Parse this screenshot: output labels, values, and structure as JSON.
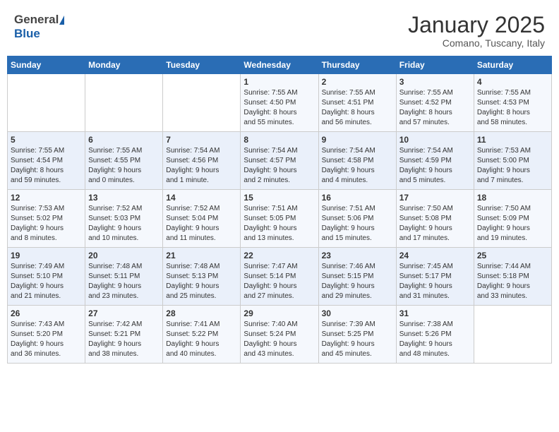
{
  "header": {
    "logo_general": "General",
    "logo_blue": "Blue",
    "month_title": "January 2025",
    "subtitle": "Comano, Tuscany, Italy"
  },
  "days_of_week": [
    "Sunday",
    "Monday",
    "Tuesday",
    "Wednesday",
    "Thursday",
    "Friday",
    "Saturday"
  ],
  "weeks": [
    [
      {
        "day": "",
        "info": ""
      },
      {
        "day": "",
        "info": ""
      },
      {
        "day": "",
        "info": ""
      },
      {
        "day": "1",
        "info": "Sunrise: 7:55 AM\nSunset: 4:50 PM\nDaylight: 8 hours\nand 55 minutes."
      },
      {
        "day": "2",
        "info": "Sunrise: 7:55 AM\nSunset: 4:51 PM\nDaylight: 8 hours\nand 56 minutes."
      },
      {
        "day": "3",
        "info": "Sunrise: 7:55 AM\nSunset: 4:52 PM\nDaylight: 8 hours\nand 57 minutes."
      },
      {
        "day": "4",
        "info": "Sunrise: 7:55 AM\nSunset: 4:53 PM\nDaylight: 8 hours\nand 58 minutes."
      }
    ],
    [
      {
        "day": "5",
        "info": "Sunrise: 7:55 AM\nSunset: 4:54 PM\nDaylight: 8 hours\nand 59 minutes."
      },
      {
        "day": "6",
        "info": "Sunrise: 7:55 AM\nSunset: 4:55 PM\nDaylight: 9 hours\nand 0 minutes."
      },
      {
        "day": "7",
        "info": "Sunrise: 7:54 AM\nSunset: 4:56 PM\nDaylight: 9 hours\nand 1 minute."
      },
      {
        "day": "8",
        "info": "Sunrise: 7:54 AM\nSunset: 4:57 PM\nDaylight: 9 hours\nand 2 minutes."
      },
      {
        "day": "9",
        "info": "Sunrise: 7:54 AM\nSunset: 4:58 PM\nDaylight: 9 hours\nand 4 minutes."
      },
      {
        "day": "10",
        "info": "Sunrise: 7:54 AM\nSunset: 4:59 PM\nDaylight: 9 hours\nand 5 minutes."
      },
      {
        "day": "11",
        "info": "Sunrise: 7:53 AM\nSunset: 5:00 PM\nDaylight: 9 hours\nand 7 minutes."
      }
    ],
    [
      {
        "day": "12",
        "info": "Sunrise: 7:53 AM\nSunset: 5:02 PM\nDaylight: 9 hours\nand 8 minutes."
      },
      {
        "day": "13",
        "info": "Sunrise: 7:52 AM\nSunset: 5:03 PM\nDaylight: 9 hours\nand 10 minutes."
      },
      {
        "day": "14",
        "info": "Sunrise: 7:52 AM\nSunset: 5:04 PM\nDaylight: 9 hours\nand 11 minutes."
      },
      {
        "day": "15",
        "info": "Sunrise: 7:51 AM\nSunset: 5:05 PM\nDaylight: 9 hours\nand 13 minutes."
      },
      {
        "day": "16",
        "info": "Sunrise: 7:51 AM\nSunset: 5:06 PM\nDaylight: 9 hours\nand 15 minutes."
      },
      {
        "day": "17",
        "info": "Sunrise: 7:50 AM\nSunset: 5:08 PM\nDaylight: 9 hours\nand 17 minutes."
      },
      {
        "day": "18",
        "info": "Sunrise: 7:50 AM\nSunset: 5:09 PM\nDaylight: 9 hours\nand 19 minutes."
      }
    ],
    [
      {
        "day": "19",
        "info": "Sunrise: 7:49 AM\nSunset: 5:10 PM\nDaylight: 9 hours\nand 21 minutes."
      },
      {
        "day": "20",
        "info": "Sunrise: 7:48 AM\nSunset: 5:11 PM\nDaylight: 9 hours\nand 23 minutes."
      },
      {
        "day": "21",
        "info": "Sunrise: 7:48 AM\nSunset: 5:13 PM\nDaylight: 9 hours\nand 25 minutes."
      },
      {
        "day": "22",
        "info": "Sunrise: 7:47 AM\nSunset: 5:14 PM\nDaylight: 9 hours\nand 27 minutes."
      },
      {
        "day": "23",
        "info": "Sunrise: 7:46 AM\nSunset: 5:15 PM\nDaylight: 9 hours\nand 29 minutes."
      },
      {
        "day": "24",
        "info": "Sunrise: 7:45 AM\nSunset: 5:17 PM\nDaylight: 9 hours\nand 31 minutes."
      },
      {
        "day": "25",
        "info": "Sunrise: 7:44 AM\nSunset: 5:18 PM\nDaylight: 9 hours\nand 33 minutes."
      }
    ],
    [
      {
        "day": "26",
        "info": "Sunrise: 7:43 AM\nSunset: 5:20 PM\nDaylight: 9 hours\nand 36 minutes."
      },
      {
        "day": "27",
        "info": "Sunrise: 7:42 AM\nSunset: 5:21 PM\nDaylight: 9 hours\nand 38 minutes."
      },
      {
        "day": "28",
        "info": "Sunrise: 7:41 AM\nSunset: 5:22 PM\nDaylight: 9 hours\nand 40 minutes."
      },
      {
        "day": "29",
        "info": "Sunrise: 7:40 AM\nSunset: 5:24 PM\nDaylight: 9 hours\nand 43 minutes."
      },
      {
        "day": "30",
        "info": "Sunrise: 7:39 AM\nSunset: 5:25 PM\nDaylight: 9 hours\nand 45 minutes."
      },
      {
        "day": "31",
        "info": "Sunrise: 7:38 AM\nSunset: 5:26 PM\nDaylight: 9 hours\nand 48 minutes."
      },
      {
        "day": "",
        "info": ""
      }
    ]
  ]
}
